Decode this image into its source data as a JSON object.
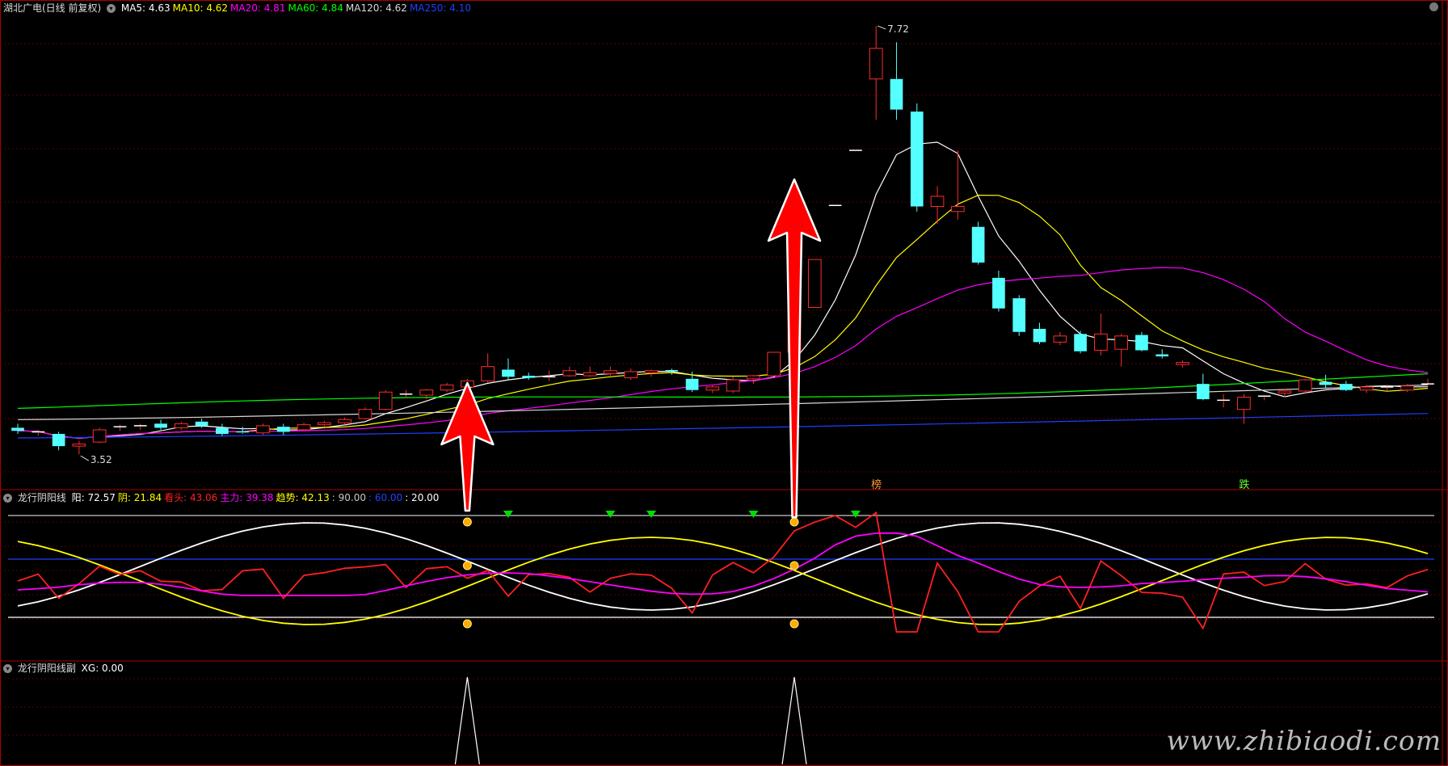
{
  "main_panel": {
    "title": "湖北广电(日线 前复权)",
    "ma_legend": [
      {
        "label": "MA5: 4.63",
        "color": "#ffffff"
      },
      {
        "label": "MA10: 4.62",
        "color": "#ffff00"
      },
      {
        "label": "MA20: 4.81",
        "color": "#ff00ff"
      },
      {
        "label": "MA60: 4.84",
        "color": "#00ff00"
      },
      {
        "label": "MA120: 4.62",
        "color": "#d8d8d8"
      },
      {
        "label": "MA250: 4.10",
        "color": "#1f3fff"
      }
    ],
    "high_label": "7.72",
    "low_label": "3.52",
    "markers": [
      {
        "text": "榜",
        "color": "#ff9933"
      },
      {
        "text": "跌",
        "color": "#66ff33"
      }
    ]
  },
  "indicator_panel": {
    "title": "龙行阴阳线",
    "values": [
      {
        "label": "阳: 72.57",
        "color": "#ffffff"
      },
      {
        "label": "阴: 21.84",
        "color": "#ffff00"
      },
      {
        "label": "看头: 43.06",
        "color": "#ff2020"
      },
      {
        "label": "主力: 39.38",
        "color": "#ff00ff"
      },
      {
        "label": "趋势: 42.13",
        "color": "#ffff00"
      },
      {
        "label": ": 90.00",
        "color": "#c8c8c8"
      },
      {
        "label": ": 60.00",
        "color": "#2040ff"
      },
      {
        "label": ": 20.00",
        "color": "#ffffff"
      }
    ]
  },
  "sub_panel": {
    "title": "龙行阴阳线副",
    "values": [
      {
        "label": "XG: 0.00",
        "color": "#ffffff"
      }
    ]
  },
  "watermark": "www.zhibiaodi.com",
  "colors": {
    "up": "#ff2b2b",
    "down": "#54ffff",
    "grid": "#5a0000",
    "frame": "#aa0000",
    "arrow": "#ff0000"
  },
  "chart_data": {
    "type": "candlestick",
    "title": "湖北广电(日线 前复权)",
    "ylim": [
      3.3,
      7.8
    ],
    "candles": [
      [
        3.78,
        3.82,
        3.72,
        3.75
      ],
      [
        3.73,
        3.76,
        3.7,
        3.74
      ],
      [
        3.72,
        3.74,
        3.56,
        3.6
      ],
      [
        3.6,
        3.65,
        3.52,
        3.62
      ],
      [
        3.64,
        3.78,
        3.63,
        3.76
      ],
      [
        3.78,
        3.81,
        3.75,
        3.79
      ],
      [
        3.79,
        3.82,
        3.76,
        3.8
      ],
      [
        3.82,
        3.86,
        3.76,
        3.78
      ],
      [
        3.78,
        3.84,
        3.76,
        3.82
      ],
      [
        3.84,
        3.87,
        3.78,
        3.8
      ],
      [
        3.78,
        3.82,
        3.7,
        3.72
      ],
      [
        3.74,
        3.79,
        3.72,
        3.73
      ],
      [
        3.73,
        3.82,
        3.71,
        3.8
      ],
      [
        3.79,
        3.82,
        3.71,
        3.74
      ],
      [
        3.76,
        3.83,
        3.75,
        3.81
      ],
      [
        3.81,
        3.85,
        3.79,
        3.83
      ],
      [
        3.83,
        3.88,
        3.81,
        3.86
      ],
      [
        3.87,
        3.98,
        3.86,
        3.96
      ],
      [
        3.96,
        4.15,
        3.95,
        4.13
      ],
      [
        4.11,
        4.15,
        4.07,
        4.11
      ],
      [
        4.1,
        4.16,
        4.06,
        4.15
      ],
      [
        4.15,
        4.22,
        4.13,
        4.2
      ],
      [
        4.18,
        4.26,
        4.15,
        4.24
      ],
      [
        4.24,
        4.51,
        4.22,
        4.38
      ],
      [
        4.35,
        4.46,
        4.25,
        4.28
      ],
      [
        4.29,
        4.32,
        4.25,
        4.27
      ],
      [
        4.27,
        4.34,
        4.24,
        4.28
      ],
      [
        4.29,
        4.38,
        4.28,
        4.34
      ],
      [
        4.29,
        4.38,
        4.28,
        4.32
      ],
      [
        4.31,
        4.38,
        4.29,
        4.34
      ],
      [
        4.27,
        4.36,
        4.25,
        4.33
      ],
      [
        4.32,
        4.35,
        4.28,
        4.34
      ],
      [
        4.34,
        4.36,
        4.3,
        4.33
      ],
      [
        4.26,
        4.33,
        4.13,
        4.15
      ],
      [
        4.15,
        4.2,
        4.12,
        4.18
      ],
      [
        4.14,
        4.28,
        4.12,
        4.25
      ],
      [
        4.26,
        4.3,
        4.21,
        4.29
      ],
      [
        4.29,
        4.52,
        4.29,
        4.52
      ],
      [
        4.52,
        4.96,
        4.52,
        4.96
      ],
      [
        4.96,
        5.43,
        4.96,
        5.43
      ],
      [
        5.96,
        5.96,
        5.96,
        5.96
      ],
      [
        6.5,
        6.5,
        6.5,
        6.5
      ],
      [
        7.2,
        7.72,
        6.8,
        7.5
      ],
      [
        7.2,
        7.56,
        6.8,
        6.9
      ],
      [
        6.88,
        6.96,
        5.9,
        5.95
      ],
      [
        5.95,
        6.15,
        5.78,
        6.05
      ],
      [
        5.9,
        6.5,
        5.82,
        5.95
      ],
      [
        5.75,
        5.8,
        5.38,
        5.4
      ],
      [
        5.25,
        5.32,
        4.92,
        4.95
      ],
      [
        5.05,
        5.08,
        4.68,
        4.72
      ],
      [
        4.75,
        4.81,
        4.6,
        4.62
      ],
      [
        4.62,
        4.72,
        4.59,
        4.68
      ],
      [
        4.7,
        4.73,
        4.51,
        4.53
      ],
      [
        4.54,
        4.9,
        4.49,
        4.7
      ],
      [
        4.55,
        4.7,
        4.38,
        4.68
      ],
      [
        4.69,
        4.72,
        4.53,
        4.54
      ],
      [
        4.5,
        4.55,
        4.46,
        4.48
      ],
      [
        4.4,
        4.44,
        4.37,
        4.42
      ],
      [
        4.21,
        4.31,
        4.05,
        4.06
      ],
      [
        4.04,
        4.11,
        3.98,
        4.05
      ],
      [
        3.96,
        4.11,
        3.82,
        4.08
      ],
      [
        4.08,
        4.1,
        4.05,
        4.09
      ],
      [
        4.12,
        4.16,
        4.08,
        4.14
      ],
      [
        4.14,
        4.26,
        4.12,
        4.25
      ],
      [
        4.23,
        4.3,
        4.17,
        4.2
      ],
      [
        4.21,
        4.24,
        4.14,
        4.15
      ],
      [
        4.15,
        4.2,
        4.12,
        4.18
      ],
      [
        4.17,
        4.2,
        4.14,
        4.18
      ],
      [
        4.15,
        4.21,
        4.13,
        4.19
      ],
      [
        4.2,
        4.26,
        4.18,
        4.21
      ]
    ],
    "indicator": {
      "levels": [
        90,
        60,
        20
      ],
      "signals": [
        22,
        38
      ]
    },
    "sub": {
      "signals": [
        22,
        38
      ]
    }
  }
}
